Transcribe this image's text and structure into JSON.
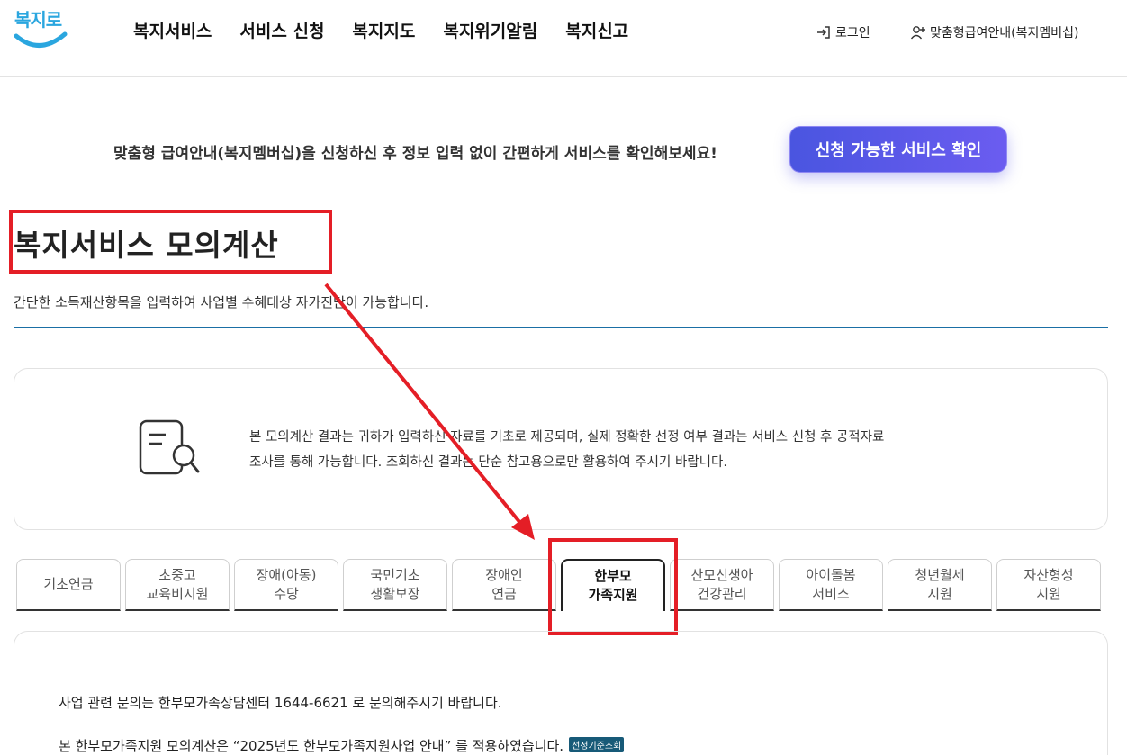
{
  "header": {
    "logo_text": "복지로",
    "nav": [
      "복지서비스",
      "서비스 신청",
      "복지지도",
      "복지위기알림",
      "복지신고"
    ],
    "login_label": "로그인",
    "membership_label": "맞춤형급여안내(복지멤버십)"
  },
  "banner": {
    "text": "맞춤형 급여안내(복지멤버십)을 신청하신 후 정보 입력 없이 간편하게 서비스를 확인해보세요!",
    "button_label": "신청 가능한 서비스 확인"
  },
  "page": {
    "title": "복지서비스 모의계산",
    "subtitle": "간단한 소득재산항목을 입력하여 사업별 수혜대상 자가진단이 가능합니다."
  },
  "notice": {
    "line1": "본 모의계산 결과는 귀하가 입력하신 자료를 기초로 제공되며, 실제 정확한 선정 여부 결과는 서비스 신청 후 공적자료",
    "line2": "조사를 통해 가능합니다. 조회하신 결과는 단순 참고용으로만 활용하여 주시기 바랍니다."
  },
  "tabs": [
    {
      "line1": "기초연금",
      "line2": ""
    },
    {
      "line1": "초중고",
      "line2": "교육비지원"
    },
    {
      "line1": "장애(아동)",
      "line2": "수당"
    },
    {
      "line1": "국민기초",
      "line2": "생활보장"
    },
    {
      "line1": "장애인",
      "line2": "연금"
    },
    {
      "line1": "한부모",
      "line2": "가족지원"
    },
    {
      "line1": "산모신생아",
      "line2": "건강관리"
    },
    {
      "line1": "아이돌봄",
      "line2": "서비스"
    },
    {
      "line1": "청년월세",
      "line2": "지원"
    },
    {
      "line1": "자산형성",
      "line2": "지원"
    }
  ],
  "active_tab_index": 5,
  "content": {
    "line1": "사업 관련 문의는 한부모가족상담센터 1644-6621 로 문의해주시기 바랍니다.",
    "line2": "본 한부모가족지원 모의계산은 “2025년도 한부모가족지원사업 안내” 를 적용하였습니다.",
    "badge": "선정기준조회"
  },
  "colors": {
    "accent": "#4a55e0",
    "highlight": "#e41e26",
    "rule": "#1a6fa5",
    "badge": "#175a78",
    "logo": "#2aa6df"
  }
}
